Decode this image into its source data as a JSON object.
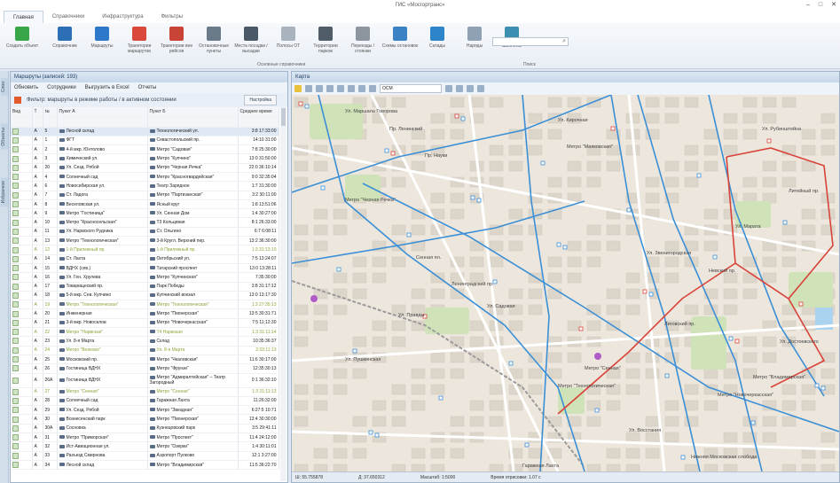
{
  "window": {
    "title": "ГИС «Мосгортранс»",
    "controls": [
      "–",
      "□",
      "✕"
    ]
  },
  "tabs": [
    "Главная",
    "Справочники",
    "Инфраструктура",
    "Фильтры"
  ],
  "ribbon": {
    "buttons": [
      {
        "label": "Создать объект",
        "icon": "add-icon",
        "color": "#3aa64a"
      },
      {
        "label": "Справочник",
        "icon": "gear-icon",
        "color": "#2c6fb6"
      },
      {
        "label": "Маршруты",
        "icon": "route-icon",
        "color": "#2d78c8"
      },
      {
        "label": "Траектории маршрутов",
        "icon": "trajectory-icon",
        "color": "#d9483b"
      },
      {
        "label": "Траектории вне рейсов",
        "icon": "trajectory-icon",
        "color": "#c94437"
      },
      {
        "label": "Остановочные пункты",
        "icon": "bus-stop-icon",
        "color": "#6b7a89"
      },
      {
        "label": "Места посадки / высадки",
        "icon": "boarding-icon",
        "color": "#4b5866"
      },
      {
        "label": "Полосы ОТ",
        "icon": "lane-icon",
        "color": "#a9b3bd"
      },
      {
        "label": "Территории парков",
        "icon": "park-icon",
        "color": "#505c68"
      },
      {
        "label": "Переезды / стоянки",
        "icon": "crossing-icon",
        "color": "#8d969f"
      },
      {
        "label": "Схемы остановок",
        "icon": "scheme-icon",
        "color": "#3b82c4"
      },
      {
        "label": "Склады",
        "icon": "warehouse-icon",
        "color": "#2d84c9"
      },
      {
        "label": "Наряды",
        "icon": "orders-icon",
        "color": "#8fa1b3"
      },
      {
        "label": "Шаблоны",
        "icon": "template-icon",
        "color": "#3c8fb0"
      }
    ],
    "group_main": "Основные справочники",
    "group_search": "Поиск"
  },
  "sidebar_tabs": [
    "Слои",
    "Объекты",
    "Избранное"
  ],
  "routes_panel": {
    "title": "Маршруты (записей: 193)",
    "toolbar": [
      "Обновить",
      "Сотрудники",
      "Выгрузить в Excel",
      "Отчеты"
    ],
    "filter_text": "Фильтр: маршруты в режиме работы / в активном состоянии",
    "settings_button": "Настройка",
    "columns": [
      "Вид",
      "Т",
      "№",
      "Пункт А",
      "Пункт Б",
      "Среднее время"
    ],
    "rows": [
      [
        "А",
        "5",
        "Лесной склад",
        "Технологический ул.",
        "3:8 17:33:00",
        "sel"
      ],
      [
        "А",
        "1",
        "ФГТ",
        "Севастопольский пр.",
        "14:10 31:00",
        ""
      ],
      [
        "А",
        "2",
        "4-й мкр. Юнтолово",
        "Метро \"Садовая\"",
        "7:8 25:30:00",
        ""
      ],
      [
        "А",
        "3",
        "Химический ул.",
        "Метро \"Купчино\"",
        "13:0 31:50:00",
        ""
      ],
      [
        "А",
        "20",
        "Ул. Сезд. Рябой",
        "Метро \"Черная Речка\"",
        "22:0 36:10:14",
        ""
      ],
      [
        "А",
        "4",
        "Солнечный сад",
        "Метро \"Красногвардейская\"",
        "9:0 32:35:04",
        ""
      ],
      [
        "А",
        "6",
        "Новосибирская ул.",
        "Театр Зарядное",
        "1:7 31:30:00",
        ""
      ],
      [
        "А",
        "7",
        "Ст. Ладога",
        "Метро \"Партизанская\"",
        "3:2 30:11:00",
        ""
      ],
      [
        "А",
        "8",
        "Веселовская ул.",
        "Ясный круг",
        "1:8 13:51:06",
        ""
      ],
      [
        "А",
        "9",
        "Метро \"Гостиница\"",
        "Ул. Сенная Дом",
        "1:4 30:27:00",
        ""
      ],
      [
        "А",
        "10",
        "Метро \"Красносельская\"",
        "Т3 Кольцевая",
        "8:1 26:33:00",
        ""
      ],
      [
        "А",
        "11",
        "Ул. Нарвского Рудника",
        "Ст. Ольгино",
        "6:7 6:08:11",
        ""
      ],
      [
        "А",
        "13",
        "Метро \"Технологическая\"",
        "3-й Кругл. Верхний пер.",
        "13:2 36:30:00",
        ""
      ],
      [
        "А",
        "12",
        "1-й Прилежный пр.",
        "1-й Прилежный пр.",
        "1:3 31:13:10",
        "hl"
      ],
      [
        "А",
        "14",
        "Ст. Лахта",
        "Октябрьский ул.",
        "7:5 13:24:07",
        ""
      ],
      [
        "А",
        "15",
        "ВДНХ (сев.)",
        "Татарский проспект",
        "13:0 13:28:11",
        ""
      ],
      [
        "А",
        "16",
        "Ул. Ген. Хрулева",
        "Метро \"Купчинская\"",
        "7:35:30:00",
        ""
      ],
      [
        "А",
        "17",
        "Товарищеский пр.",
        "Парк Победы",
        "3:8 31:17:12",
        ""
      ],
      [
        "А",
        "18",
        "5-й мкр. Сев. Купчино",
        "Купчинский вокзал",
        "13:0 13:17:30",
        ""
      ],
      [
        "А",
        "19",
        "Метро \"Технологическая\"",
        "Метро \"Технологическая\"",
        "1:3 27:35:13",
        "hl"
      ],
      [
        "А",
        "20",
        "Инженерная",
        "Метро \"Пионерская\"",
        "13:5 30:31:71",
        ""
      ],
      [
        "А",
        "21",
        "3-й мкр. Новоселов",
        "Метро \"Новочеркасская\"",
        "7:5 11:12:30",
        ""
      ],
      [
        "А",
        "22",
        "Метро \"Нарвская\"",
        "Т4 Нарвская",
        "1:3 31:11:14",
        "hl"
      ],
      [
        "А",
        "23",
        "Ул. 8-я Марта",
        "Склад",
        "10:35:36:37",
        ""
      ],
      [
        "А",
        "24",
        "Метро \"Волково\"",
        "Ул. 8-я Марта",
        "2:33:11:13",
        "hl"
      ],
      [
        "А",
        "25",
        "Московский пр.",
        "Метро \"Чкаловская\"",
        "11:6 30:17:00",
        ""
      ],
      [
        "А",
        "26",
        "Гостиница ВДНХ",
        "Метро \"Фрунзе\"",
        "12:35:30:13",
        ""
      ],
      [
        "А",
        "26А",
        "Гостиница ВДНХ",
        "Метро \"Адмиралтейская\" – Театр Загородный",
        "0:1 36:32:10",
        "two"
      ],
      [
        "А",
        "27",
        "Метро \"Сенная\"",
        "Метро \"Сенная\"",
        "1:3 31:11:13",
        "hl"
      ],
      [
        "А",
        "28",
        "Солнечный сад",
        "Гаражная Лахта",
        "11:26:32:00",
        ""
      ],
      [
        "А",
        "29",
        "Ул. Сезд. Рябой",
        "Метро \"Звездная\"",
        "6:27:5 10:71",
        ""
      ],
      [
        "А",
        "30",
        "Вознесенский парк",
        "Метро \"Пионерская\"",
        "13:4 30:30:00",
        ""
      ],
      [
        "А",
        "30А",
        "Сосновка",
        "Кузнецовский парк",
        "3:5 29:41:11",
        ""
      ],
      [
        "А",
        "31",
        "Метро \"Приморская\"",
        "Метро \"Проспект\"",
        "11:4 24:12:00",
        ""
      ],
      [
        "А",
        "32",
        "Ист-Авиационная ул.",
        "Метро \"Озерки\"",
        "1:4 30:11:01",
        ""
      ],
      [
        "А",
        "33",
        "Разъезд Смирнова",
        "Аэропорт Пулково",
        "12:1 3:27:00",
        ""
      ],
      [
        "А",
        "34",
        "Лесной склад",
        "Метро \"Владимирская\"",
        "11:5 36:22:70",
        ""
      ]
    ]
  },
  "map": {
    "title": "Карта",
    "layer_select": "ОСМ",
    "labels": [
      "Ул. Маршала Говорова",
      "Пр. Ленинский",
      "Ул. Кирочная",
      "Пр. Науки",
      "Метро \"Черная Речка\"",
      "Сенная пл.",
      "Ленинградский пр.",
      "Ул. Садовая",
      "Метро \"Сенная\"",
      "Ул. Марата",
      "Невский пр.",
      "Ул. Достоевского",
      "Метро \"Владимирская\"",
      "Лиговский пр.",
      "Метро \"Новочеркасская\"",
      "Ул. Пушкинская",
      "Ул. Восстания",
      "Метро \"Технологическая\"",
      "Нижняя Московская слобода",
      "Гаражная Лахта",
      "Ул. Звенигородская",
      "Метро \"Маяковская\"",
      "Ул. Рубинштейна",
      "Ул. Правды",
      "Литейный пр."
    ],
    "status": {
      "lat": "Ш: 55.755878",
      "lon": "Д: 37.650312",
      "scale": "Масштаб: 1:5000",
      "render": "Время отрисовки: 1.07 с"
    },
    "colors": {
      "route_blue": "#3b8fd6",
      "route_red": "#d9443a",
      "background": "#ece6dc",
      "park": "#cfe2b8"
    }
  }
}
